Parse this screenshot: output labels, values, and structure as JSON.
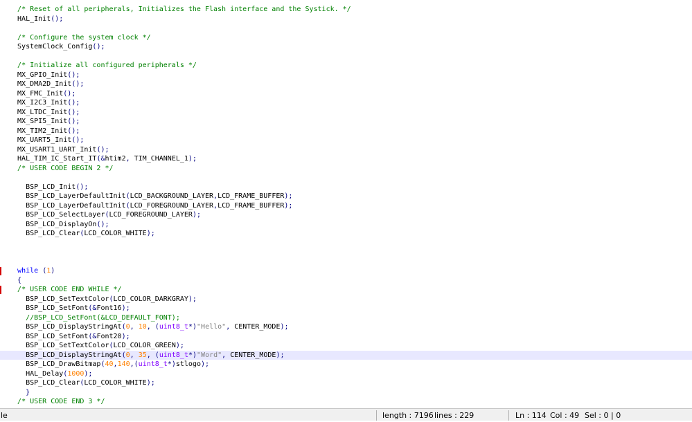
{
  "editor": {
    "current_line_index": 37,
    "error_marker_lines": [
      28,
      30
    ],
    "lines": [
      [
        {
          "t": "  "
        },
        {
          "t": "/* Reset of all peripherals, Initializes the Flash interface and the Systick. */",
          "c": "cmt"
        }
      ],
      [
        {
          "t": "  HAL_Init"
        },
        {
          "t": "();",
          "c": "op"
        }
      ],
      [],
      [
        {
          "t": "  "
        },
        {
          "t": "/* Configure the system clock */",
          "c": "cmt"
        }
      ],
      [
        {
          "t": "  SystemClock_Config"
        },
        {
          "t": "();",
          "c": "op"
        }
      ],
      [],
      [
        {
          "t": "  "
        },
        {
          "t": "/* Initialize all configured peripherals */",
          "c": "cmt"
        }
      ],
      [
        {
          "t": "  MX_GPIO_Init"
        },
        {
          "t": "();",
          "c": "op"
        }
      ],
      [
        {
          "t": "  MX_DMA2D_Init"
        },
        {
          "t": "();",
          "c": "op"
        }
      ],
      [
        {
          "t": "  MX_FMC_Init"
        },
        {
          "t": "();",
          "c": "op"
        }
      ],
      [
        {
          "t": "  MX_I2C3_Init"
        },
        {
          "t": "();",
          "c": "op"
        }
      ],
      [
        {
          "t": "  MX_LTDC_Init"
        },
        {
          "t": "();",
          "c": "op"
        }
      ],
      [
        {
          "t": "  MX_SPI5_Init"
        },
        {
          "t": "();",
          "c": "op"
        }
      ],
      [
        {
          "t": "  MX_TIM2_Init"
        },
        {
          "t": "();",
          "c": "op"
        }
      ],
      [
        {
          "t": "  MX_UART5_Init"
        },
        {
          "t": "();",
          "c": "op"
        }
      ],
      [
        {
          "t": "  MX_USART1_UART_Init"
        },
        {
          "t": "();",
          "c": "op"
        }
      ],
      [
        {
          "t": "  HAL_TIM_IC_Start_IT"
        },
        {
          "t": "(&",
          "c": "op"
        },
        {
          "t": "htim2"
        },
        {
          "t": ",",
          "c": "op"
        },
        {
          "t": " TIM_CHANNEL_1"
        },
        {
          "t": ");",
          "c": "op"
        }
      ],
      [
        {
          "t": "  "
        },
        {
          "t": "/* USER CODE BEGIN 2 */",
          "c": "cmt"
        }
      ],
      [],
      [
        {
          "t": "    BSP_LCD_Init"
        },
        {
          "t": "();",
          "c": "op"
        }
      ],
      [
        {
          "t": "    BSP_LCD_LayerDefaultInit"
        },
        {
          "t": "(",
          "c": "op"
        },
        {
          "t": "LCD_BACKGROUND_LAYER"
        },
        {
          "t": ",",
          "c": "op"
        },
        {
          "t": "LCD_FRAME_BUFFER"
        },
        {
          "t": ");",
          "c": "op"
        }
      ],
      [
        {
          "t": "    BSP_LCD_LayerDefaultInit"
        },
        {
          "t": "(",
          "c": "op"
        },
        {
          "t": "LCD_FOREGROUND_LAYER"
        },
        {
          "t": ",",
          "c": "op"
        },
        {
          "t": "LCD_FRAME_BUFFER"
        },
        {
          "t": ");",
          "c": "op"
        }
      ],
      [
        {
          "t": "    BSP_LCD_SelectLayer"
        },
        {
          "t": "(",
          "c": "op"
        },
        {
          "t": "LCD_FOREGROUND_LAYER"
        },
        {
          "t": ");",
          "c": "op"
        }
      ],
      [
        {
          "t": "    BSP_LCD_DisplayOn"
        },
        {
          "t": "();",
          "c": "op"
        }
      ],
      [
        {
          "t": "    BSP_LCD_Clear"
        },
        {
          "t": "(",
          "c": "op"
        },
        {
          "t": "LCD_COLOR_WHITE"
        },
        {
          "t": ");",
          "c": "op"
        }
      ],
      [],
      [],
      [],
      [
        {
          "t": "  "
        },
        {
          "t": "while",
          "c": "kw"
        },
        {
          "t": " "
        },
        {
          "t": "(",
          "c": "op"
        },
        {
          "t": "1",
          "c": "num"
        },
        {
          "t": ")",
          "c": "op"
        }
      ],
      [
        {
          "t": "  "
        },
        {
          "t": "{",
          "c": "op"
        }
      ],
      [
        {
          "t": "  "
        },
        {
          "t": "/* USER CODE END WHILE */",
          "c": "cmt"
        }
      ],
      [
        {
          "t": "    BSP_LCD_SetTextColor"
        },
        {
          "t": "(",
          "c": "op"
        },
        {
          "t": "LCD_COLOR_DARKGRAY"
        },
        {
          "t": ");",
          "c": "op"
        }
      ],
      [
        {
          "t": "    BSP_LCD_SetFont"
        },
        {
          "t": "(&",
          "c": "op"
        },
        {
          "t": "Font16"
        },
        {
          "t": ");",
          "c": "op"
        }
      ],
      [
        {
          "t": "    "
        },
        {
          "t": "//BSP_LCD_SetFont(&LCD_DEFAULT_FONT);",
          "c": "cmt"
        }
      ],
      [
        {
          "t": "    BSP_LCD_DisplayStringAt"
        },
        {
          "t": "(",
          "c": "op"
        },
        {
          "t": "0",
          "c": "num"
        },
        {
          "t": ",",
          "c": "op"
        },
        {
          "t": " "
        },
        {
          "t": "10",
          "c": "num"
        },
        {
          "t": ",",
          "c": "op"
        },
        {
          "t": " "
        },
        {
          "t": "(",
          "c": "op"
        },
        {
          "t": "uint8_t",
          "c": "type"
        },
        {
          "t": "*)",
          "c": "op"
        },
        {
          "t": "\"Hello\"",
          "c": "str"
        },
        {
          "t": ",",
          "c": "op"
        },
        {
          "t": " CENTER_MODE"
        },
        {
          "t": ");",
          "c": "op"
        }
      ],
      [
        {
          "t": "    BSP_LCD_SetFont"
        },
        {
          "t": "(&",
          "c": "op"
        },
        {
          "t": "Font20"
        },
        {
          "t": ");",
          "c": "op"
        }
      ],
      [
        {
          "t": "    BSP_LCD_SetTextColor"
        },
        {
          "t": "(",
          "c": "op"
        },
        {
          "t": "LCD_COLOR_GREEN"
        },
        {
          "t": ");",
          "c": "op"
        }
      ],
      [
        {
          "t": "    BSP_LCD_DisplayStringAt"
        },
        {
          "t": "(",
          "c": "op"
        },
        {
          "t": "0",
          "c": "num"
        },
        {
          "t": ",",
          "c": "op"
        },
        {
          "t": " "
        },
        {
          "t": "35",
          "c": "num"
        },
        {
          "t": ",",
          "c": "op"
        },
        {
          "t": " "
        },
        {
          "t": "(",
          "c": "op"
        },
        {
          "t": "uint8_t",
          "c": "type"
        },
        {
          "t": "*)",
          "c": "op"
        },
        {
          "t": "\"Word\"",
          "c": "str"
        },
        {
          "t": ",",
          "c": "op"
        },
        {
          "t": " CENTER_MODE"
        },
        {
          "t": ");",
          "c": "op"
        }
      ],
      [
        {
          "t": "    BSP_LCD_DrawBitmap"
        },
        {
          "t": "(",
          "c": "op"
        },
        {
          "t": "40",
          "c": "num"
        },
        {
          "t": ",",
          "c": "op"
        },
        {
          "t": "140",
          "c": "num"
        },
        {
          "t": ",(",
          "c": "op"
        },
        {
          "t": "uint8_t",
          "c": "type"
        },
        {
          "t": "*)",
          "c": "op"
        },
        {
          "t": "stlogo"
        },
        {
          "t": ");",
          "c": "op"
        }
      ],
      [
        {
          "t": "    HAL_Delay"
        },
        {
          "t": "(",
          "c": "op"
        },
        {
          "t": "1000",
          "c": "num"
        },
        {
          "t": ");",
          "c": "op"
        }
      ],
      [
        {
          "t": "    BSP_LCD_Clear"
        },
        {
          "t": "(",
          "c": "op"
        },
        {
          "t": "LCD_COLOR_WHITE"
        },
        {
          "t": ");",
          "c": "op"
        }
      ],
      [
        {
          "t": "    "
        },
        {
          "t": "}",
          "c": "op"
        }
      ],
      [
        {
          "t": "  "
        },
        {
          "t": "/* USER CODE END 3 */",
          "c": "cmt"
        }
      ]
    ]
  },
  "statusbar": {
    "file_type_fragment": "le",
    "length": "length : 7196",
    "lines": "lines : 229",
    "ln": "Ln : 114",
    "col": "Col : 49",
    "sel": "Sel : 0 | 0"
  }
}
